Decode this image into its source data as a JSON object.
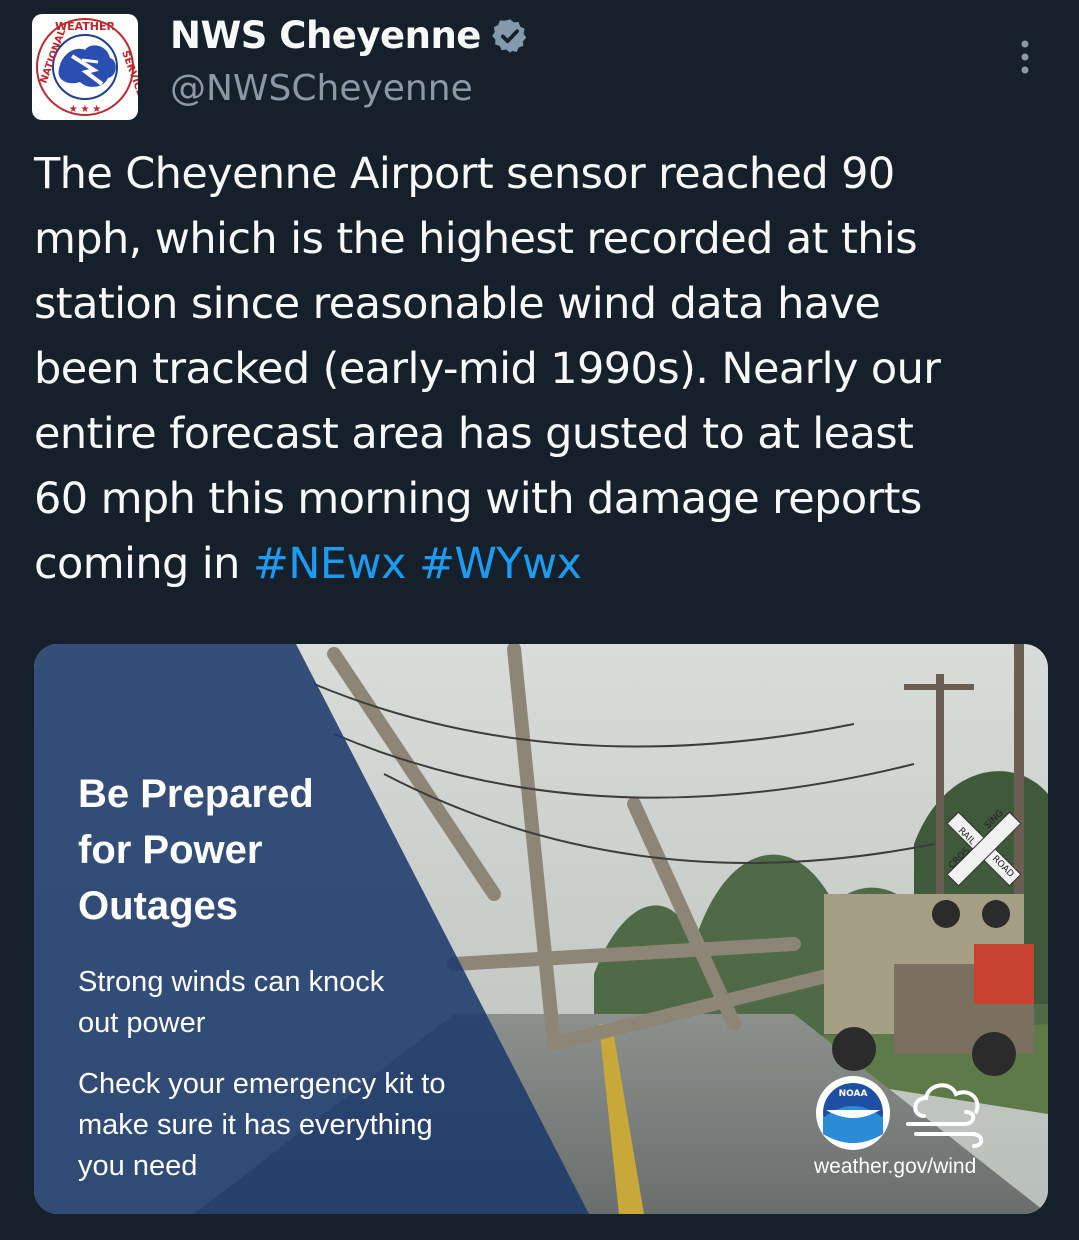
{
  "account": {
    "display_name": "NWS Cheyenne",
    "handle": "@NWSCheyenne",
    "verified": true,
    "avatar_text_top": "WEATHER",
    "avatar_text_left": "NATIONAL",
    "avatar_text_right": "SERVICE"
  },
  "tweet": {
    "lines": [
      "The Cheyenne Airport sensor reached 90",
      "mph, which is the highest recorded at this",
      "station since reasonable wind data have",
      "been tracked (early-mid 1990s). Nearly our",
      "entire forecast area has gusted to at least",
      "60 mph this morning with damage reports"
    ],
    "last_line_prefix": "coming in ",
    "hashtags": [
      "#NEwx",
      "#WYwx"
    ]
  },
  "media": {
    "title_lines": [
      "Be Prepared",
      "for Power",
      "Outages"
    ],
    "body_lines": [
      "Strong winds can knock",
      "out power",
      "Check your emergency kit to",
      "make sure it has everything",
      "you need"
    ],
    "url": "weather.gov/wind",
    "noaa_label": "NOAA",
    "sign_top": "RAIL",
    "sign_side": "SING",
    "sign_left": "CROS",
    "sign_bottom": "ROAD"
  },
  "colors": {
    "background": "#15202b",
    "text": "#f7f9f9",
    "secondary": "#8b98a5",
    "link": "#1d9bf0",
    "card_overlay": "#1c3a6b"
  },
  "icons": [
    "verified-badge-icon",
    "more-options-icon",
    "noaa-logo-icon",
    "wind-icon"
  ]
}
